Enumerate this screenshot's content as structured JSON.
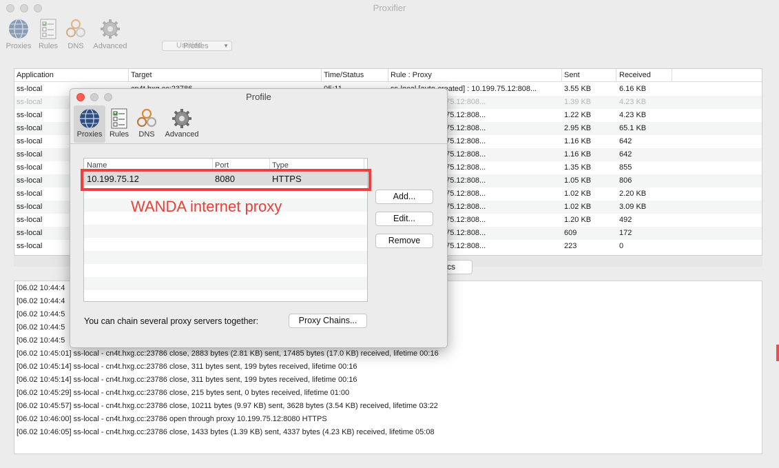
{
  "window": {
    "title": "Proxifier"
  },
  "toolbar": {
    "items": [
      {
        "label": "Proxies",
        "icon": "globe-icon"
      },
      {
        "label": "Rules",
        "icon": "rules-checklist-icon"
      },
      {
        "label": "DNS",
        "icon": "dns-icon"
      },
      {
        "label": "Advanced",
        "icon": "gear-icon"
      }
    ],
    "profile_select": "Untitled",
    "profiles_label": "Profiles"
  },
  "connections": {
    "columns": [
      "Application",
      "Target",
      "Time/Status",
      "Rule : Proxy",
      "Sent",
      "Received"
    ],
    "rows": [
      {
        "app": "ss-local",
        "target": "cn4t.hxg.cc:23786",
        "time": "05:11",
        "rule": "ss-local [auto-created] : 10.199.75.12:808...",
        "sent": "3.55 KB",
        "recv": "6.16 KB"
      },
      {
        "app": "ss-local",
        "target": "",
        "time": "",
        "rule": "reated] : 10.199.75.12:808...",
        "sent": "1.39 KB",
        "recv": "4.23 KB"
      },
      {
        "app": "ss-local",
        "target": "",
        "time": "",
        "rule": "reated] : 10.199.75.12:808...",
        "sent": "1.22 KB",
        "recv": "4.23 KB"
      },
      {
        "app": "ss-local",
        "target": "",
        "time": "",
        "rule": "reated] : 10.199.75.12:808...",
        "sent": "2.95 KB",
        "recv": "65.1 KB"
      },
      {
        "app": "ss-local",
        "target": "",
        "time": "",
        "rule": "reated] : 10.199.75.12:808...",
        "sent": "1.16 KB",
        "recv": "642"
      },
      {
        "app": "ss-local",
        "target": "",
        "time": "",
        "rule": "reated] : 10.199.75.12:808...",
        "sent": "1.16 KB",
        "recv": "642"
      },
      {
        "app": "ss-local",
        "target": "",
        "time": "",
        "rule": "reated] : 10.199.75.12:808...",
        "sent": "1.35 KB",
        "recv": "855"
      },
      {
        "app": "ss-local",
        "target": "",
        "time": "",
        "rule": "reated] : 10.199.75.12:808...",
        "sent": "1.05 KB",
        "recv": "806"
      },
      {
        "app": "ss-local",
        "target": "",
        "time": "",
        "rule": "reated] : 10.199.75.12:808...",
        "sent": "1.02 KB",
        "recv": "2.20 KB"
      },
      {
        "app": "ss-local",
        "target": "",
        "time": "",
        "rule": "reated] : 10.199.75.12:808...",
        "sent": "1.02 KB",
        "recv": "3.09 KB"
      },
      {
        "app": "ss-local",
        "target": "",
        "time": "",
        "rule": "reated] : 10.199.75.12:808...",
        "sent": "1.20 KB",
        "recv": "492"
      },
      {
        "app": "ss-local",
        "target": "",
        "time": "",
        "rule": "reated] : 10.199.75.12:808...",
        "sent": "609",
        "recv": "172"
      },
      {
        "app": "ss-local",
        "target": "",
        "time": "",
        "rule": "reated] : 10.199.75.12:808...",
        "sent": "223",
        "recv": "0"
      }
    ],
    "statistics_button": "tics"
  },
  "log": {
    "lines": [
      "[06.02 10:44:4",
      "[06.02 10:44:4",
      "[06.02 10:44:5",
      "[06.02 10:44:5",
      "[06.02 10:44:5",
      "[06.02 10:45:01] ss-local - cn4t.hxg.cc:23786 close, 2883 bytes (2.81 KB) sent, 17485 bytes (17.0 KB) received, lifetime 00:16",
      "[06.02 10:45:14] ss-local - cn4t.hxg.cc:23786 close, 311 bytes sent, 199 bytes received, lifetime 00:16",
      "[06.02 10:45:14] ss-local - cn4t.hxg.cc:23786 close, 311 bytes sent, 199 bytes received, lifetime 00:16",
      "[06.02 10:45:29] ss-local - cn4t.hxg.cc:23786 close, 215 bytes sent, 0 bytes received, lifetime 01:00",
      "[06.02 10:45:57] ss-local - cn4t.hxg.cc:23786 close, 10211 bytes (9.97 KB) sent, 3628 bytes (3.54 KB) received, lifetime 03:22",
      "[06.02 10:46:00] ss-local - cn4t.hxg.cc:23786 open through proxy 10.199.75.12:8080 HTTPS",
      "[06.02 10:46:05] ss-local - cn4t.hxg.cc:23786 close, 1433 bytes (1.39 KB) sent, 4337 bytes (4.23 KB) received, lifetime 05:08"
    ]
  },
  "dialog": {
    "title": "Profile",
    "tabs": [
      {
        "label": "Proxies",
        "icon": "globe-icon"
      },
      {
        "label": "Rules",
        "icon": "rules-checklist-icon"
      },
      {
        "label": "DNS",
        "icon": "dns-icon"
      },
      {
        "label": "Advanced",
        "icon": "gear-icon"
      }
    ],
    "table": {
      "columns": [
        "Name",
        "Port",
        "Type"
      ],
      "rows": [
        {
          "name": "10.199.75.12",
          "port": "8080",
          "type": "HTTPS"
        }
      ]
    },
    "annotation": "WANDA internet proxy",
    "buttons": {
      "add": "Add...",
      "edit": "Edit...",
      "remove": "Remove"
    },
    "chain_text": "You can chain several proxy servers together:",
    "chain_button": "Proxy Chains..."
  },
  "colors": {
    "highlight": "#ee4040",
    "annotation": "#e8403a",
    "close_button": "#fc5f57"
  }
}
